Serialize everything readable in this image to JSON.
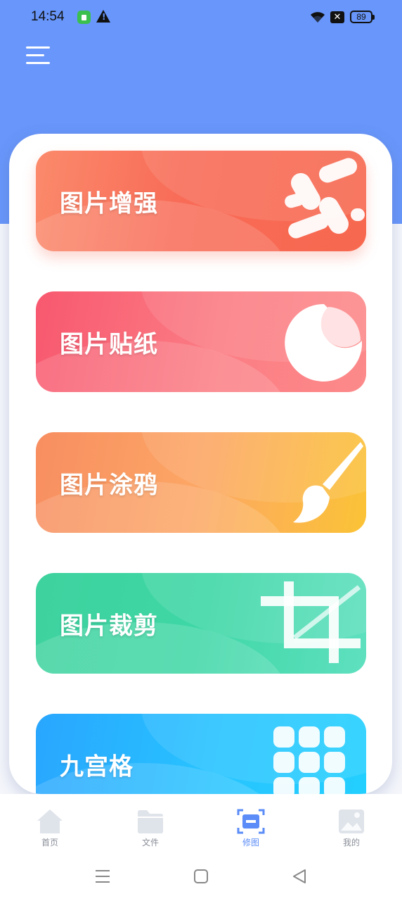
{
  "status_bar": {
    "time": "14:54",
    "battery": "89",
    "icons": [
      "app-notification-icon",
      "warning-icon",
      "wifi-icon",
      "signal-off-icon",
      "battery-icon"
    ]
  },
  "header": {
    "menu_icon": "hamburger-menu-icon"
  },
  "colors": {
    "header_bg": "#6896fa",
    "enhance": "#f7684f",
    "sticker": "#f8586f",
    "doodle": "#fca765",
    "crop": "#3ed29e",
    "grid": "#28c4ff",
    "nav_active": "#5b8cf7"
  },
  "features": [
    {
      "label": "图片增强",
      "icon": "magic-sparkle-icon"
    },
    {
      "label": "图片贴纸",
      "icon": "sticker-peel-icon"
    },
    {
      "label": "图片涂鸦",
      "icon": "paint-brush-icon"
    },
    {
      "label": "图片裁剪",
      "icon": "crop-icon"
    },
    {
      "label": "九宫格",
      "icon": "nine-grid-icon"
    }
  ],
  "bottom_nav": [
    {
      "label": "首页",
      "icon": "home-icon",
      "active": false
    },
    {
      "label": "文件",
      "icon": "folder-icon",
      "active": false
    },
    {
      "label": "修图",
      "icon": "edit-scan-icon",
      "active": true
    },
    {
      "label": "我的",
      "icon": "image-profile-icon",
      "active": false
    }
  ],
  "system_nav": [
    "recents-icon",
    "home-square-icon",
    "back-triangle-icon"
  ]
}
